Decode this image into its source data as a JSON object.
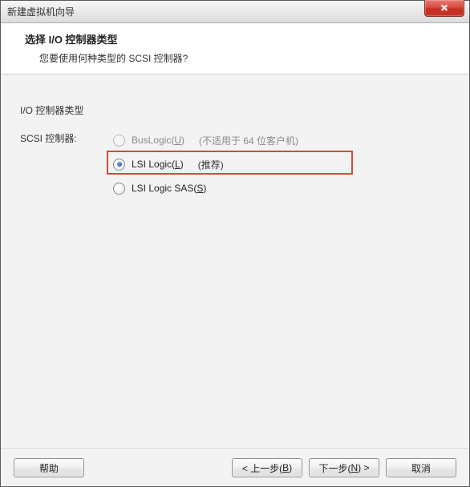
{
  "window": {
    "title": "新建虚拟机向导",
    "close_glyph": "✕"
  },
  "header": {
    "title": "选择 I/O 控制器类型",
    "subtitle": "您要使用何种类型的 SCSI 控制器?"
  },
  "body": {
    "section_title": "I/O 控制器类型",
    "field_label": "SCSI 控制器:",
    "options": [
      {
        "label_pre": "BusLogic(",
        "label_key": "U",
        "label_post": ")",
        "hint": "(不适用于 64 位客户机)",
        "checked": false,
        "disabled": true
      },
      {
        "label_pre": "LSI Logic(",
        "label_key": "L",
        "label_post": ")",
        "hint": "(推荐)",
        "checked": true,
        "disabled": false
      },
      {
        "label_pre": "LSI Logic SAS(",
        "label_key": "S",
        "label_post": ")",
        "hint": "",
        "checked": false,
        "disabled": false
      }
    ]
  },
  "footer": {
    "help": "帮助",
    "back_pre": "< 上一步(",
    "back_key": "B",
    "back_post": ")",
    "next_pre": "下一步(",
    "next_key": "N",
    "next_post": ") >",
    "cancel": "取消"
  }
}
